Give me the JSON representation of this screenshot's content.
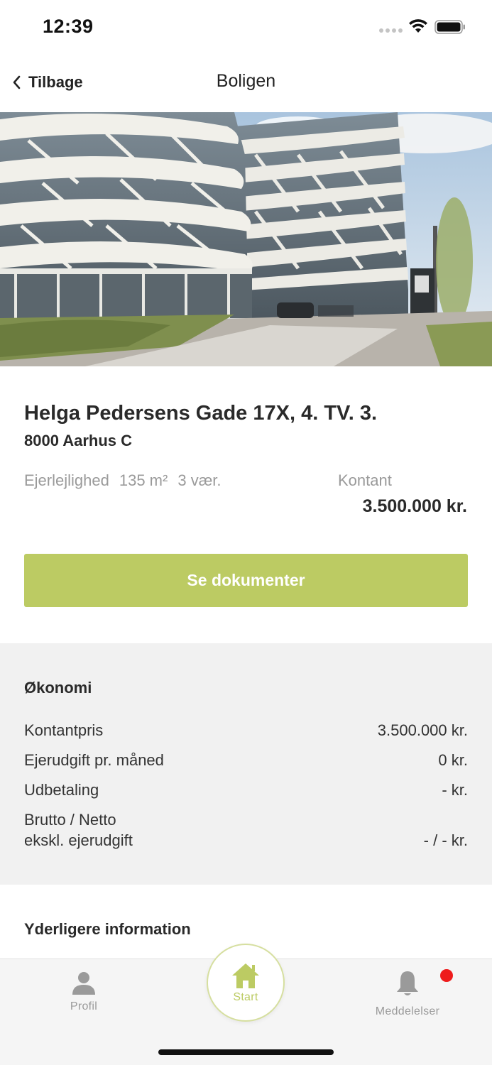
{
  "status_bar": {
    "time": "12:39"
  },
  "nav": {
    "back_label": "Tilbage",
    "title": "Boligen"
  },
  "property": {
    "address": "Helga Pedersens Gade 17X, 4. TV. 3.",
    "city": "8000 Aarhus C",
    "type": "Ejerlejlighed",
    "area": "135 m²",
    "rooms": "3 vær.",
    "price_label": "Kontant",
    "price": "3.500.000 kr.",
    "documents_button": "Se dokumenter"
  },
  "economy": {
    "title": "Økonomi",
    "rows": [
      {
        "label": "Kontantpris",
        "value": "3.500.000 kr."
      },
      {
        "label": "Ejerudgift pr. måned",
        "value": "0 kr."
      },
      {
        "label": "Udbetaling",
        "value": "- kr."
      },
      {
        "label_line1": "Brutto / Netto",
        "label_line2": "ekskl. ejerudgift",
        "value": "- / - kr."
      }
    ]
  },
  "more_info": {
    "title": "Yderligere information"
  },
  "tab_bar": {
    "profile": "Profil",
    "start": "Start",
    "notifications": "Meddelelser"
  },
  "colors": {
    "accent": "#bccb63",
    "notification_dot": "#ee1c1c",
    "section_background": "#f1f1f1"
  },
  "icons": {
    "back": "chevron-left-icon",
    "wifi": "wifi-icon",
    "battery": "battery-icon",
    "profile": "person-icon",
    "start": "home-icon",
    "notifications": "bell-icon"
  }
}
